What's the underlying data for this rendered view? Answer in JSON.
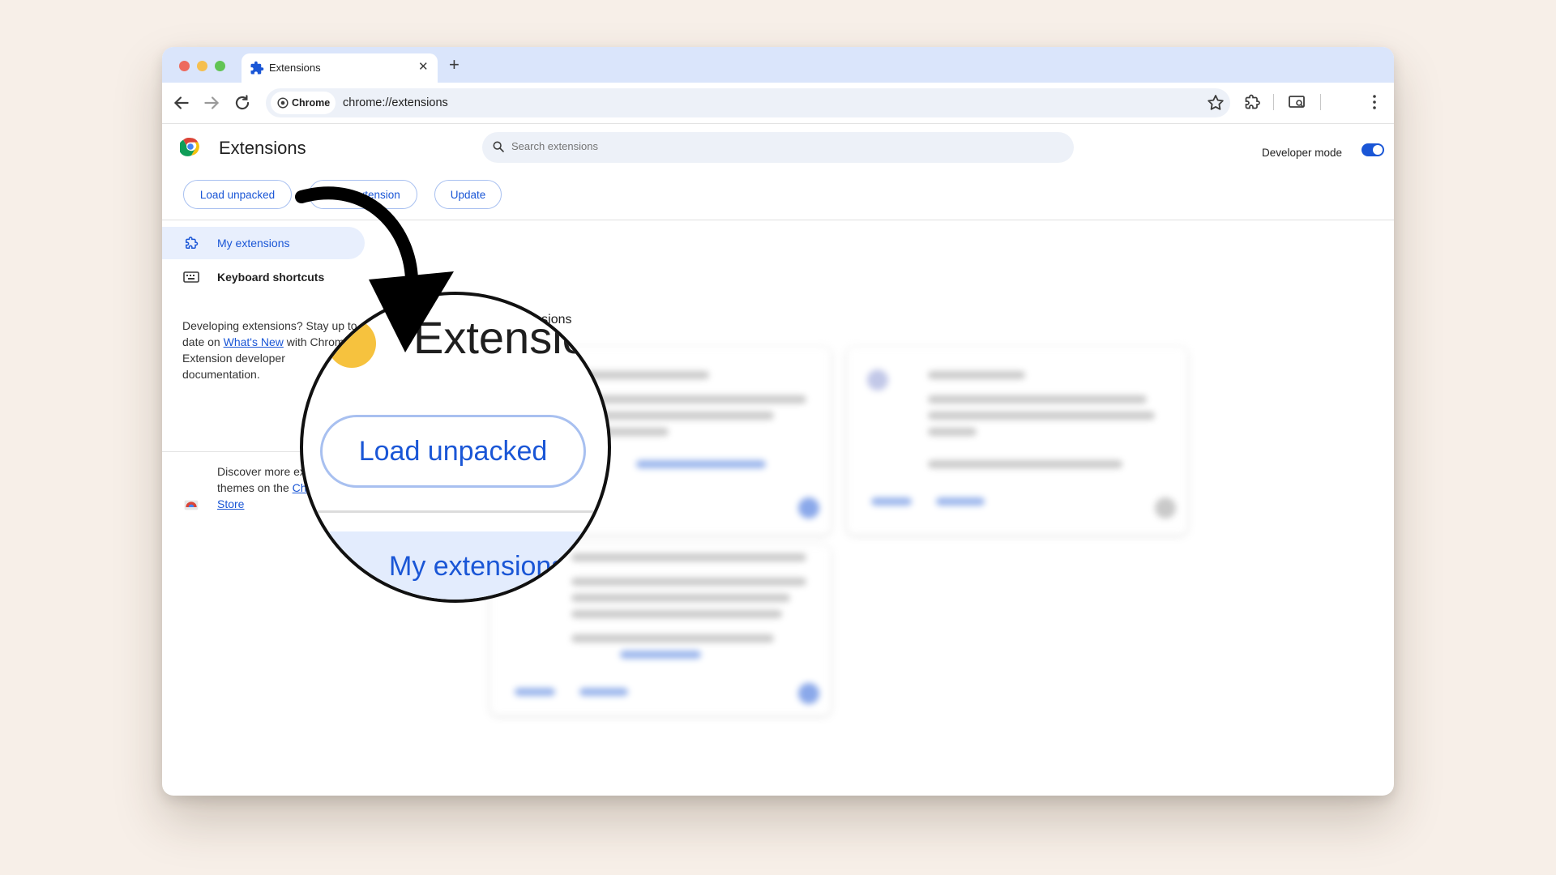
{
  "browser": {
    "tab_title": "Extensions",
    "new_tab": "+",
    "close_tab": "✕",
    "chip_label": "Chrome",
    "url": "chrome://extensions"
  },
  "header": {
    "title": "Extensions",
    "search_placeholder": "Search extensions",
    "developer_mode_label": "Developer mode",
    "developer_mode_on": true,
    "buttons": {
      "load_unpacked": "Load unpacked",
      "pack_extension": "Pack extension",
      "update": "Update"
    }
  },
  "sidebar": {
    "items": [
      {
        "label": "My extensions",
        "icon": "puzzle-icon",
        "selected": true
      },
      {
        "label": "Keyboard shortcuts",
        "icon": "keyboard-icon",
        "selected": false
      }
    ],
    "dev_note": {
      "before": "Developing extensions? Stay up to date on ",
      "link": "What's New",
      "after": " with Chrome Extension developer documentation."
    },
    "store_note": {
      "before": "Discover more extensions and themes on the ",
      "link": "Chrome Web Store",
      "after": ""
    }
  },
  "main": {
    "heading": "All Extensions"
  },
  "magnifier": {
    "title": "Extensions",
    "button": "Load unpacked",
    "nav_label": "My extensions"
  },
  "colors": {
    "accent": "#1a56d6",
    "page_background": "#f7efe8",
    "tabstrip": "#dae5fb"
  }
}
